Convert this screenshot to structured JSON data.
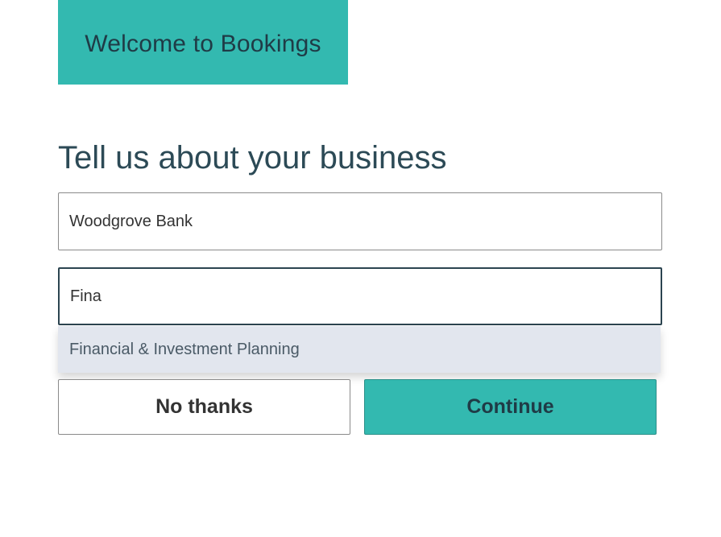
{
  "banner": {
    "title": "Welcome to Bookings"
  },
  "form": {
    "heading": "Tell us about your business",
    "business_name": {
      "value": "Woodgrove Bank"
    },
    "business_type": {
      "value": "Fina"
    },
    "suggestions": [
      "Financial & Investment Planning"
    ]
  },
  "actions": {
    "no_thanks_label": "No thanks",
    "continue_label": "Continue"
  },
  "colors": {
    "accent": "#33b9b0",
    "heading_text": "#2c4a56",
    "suggestion_bg": "#e2e6ee"
  }
}
